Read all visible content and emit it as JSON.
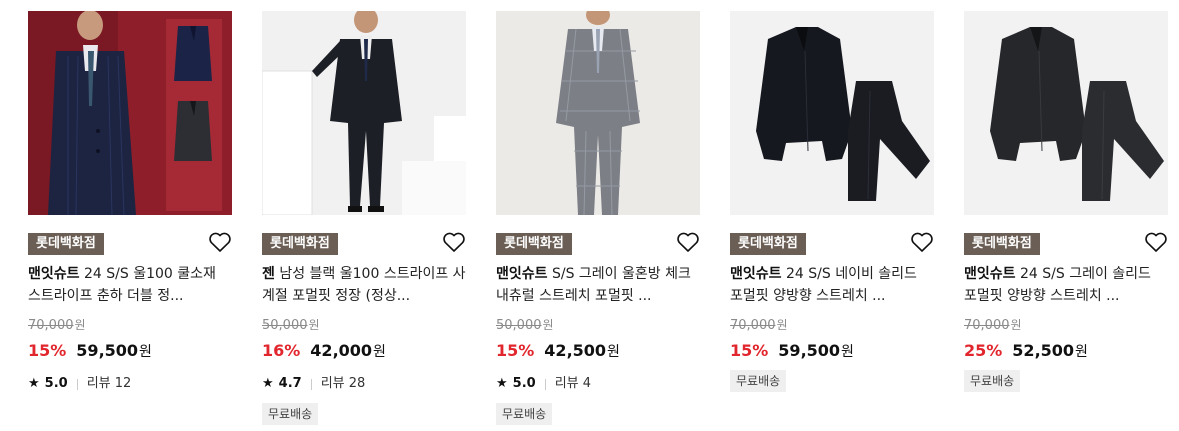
{
  "products": [
    {
      "store": "롯데백화점",
      "brand": "맨잇슈트",
      "title": "24 S/S 울100 쿨소재 스트라이프 춘하 더블 정...",
      "original_price": "70,000",
      "won": "원",
      "discount": "15%",
      "price": "59,500",
      "rating": "5.0",
      "review_label": "리뷰 12",
      "shipping": ""
    },
    {
      "store": "롯데백화점",
      "brand": "젠",
      "title": "남성 블랙 울100 스트라이프 사계절 포멀핏 정장 (정상...",
      "original_price": "50,000",
      "won": "원",
      "discount": "16%",
      "price": "42,000",
      "rating": "4.7",
      "review_label": "리뷰 28",
      "shipping": "무료배송"
    },
    {
      "store": "롯데백화점",
      "brand": "맨잇슈트",
      "title": "S/S 그레이 울혼방 체크 내츄럴 스트레치 포멀핏 ...",
      "original_price": "50,000",
      "won": "원",
      "discount": "15%",
      "price": "42,500",
      "rating": "5.0",
      "review_label": "리뷰 4",
      "shipping": "무료배송"
    },
    {
      "store": "롯데백화점",
      "brand": "맨잇슈트",
      "title": "24 S/S 네이비 솔리드 포멀핏 양방향 스트레치 ...",
      "original_price": "70,000",
      "won": "원",
      "discount": "15%",
      "price": "59,500",
      "rating": "",
      "review_label": "",
      "shipping": "무료배송"
    },
    {
      "store": "롯데백화점",
      "brand": "맨잇슈트",
      "title": "24 S/S 그레이 솔리드 포멀핏 양방향 스트레치 ...",
      "original_price": "70,000",
      "won": "원",
      "discount": "25%",
      "price": "52,500",
      "rating": "",
      "review_label": "",
      "shipping": "무료배송"
    }
  ],
  "icons": {
    "wishlist": "heart-outline-icon",
    "rating": "star-icon"
  },
  "colors": {
    "discount": "#e1262d",
    "store_badge": "#6b5e55",
    "shipping_badge": "#efefef"
  }
}
